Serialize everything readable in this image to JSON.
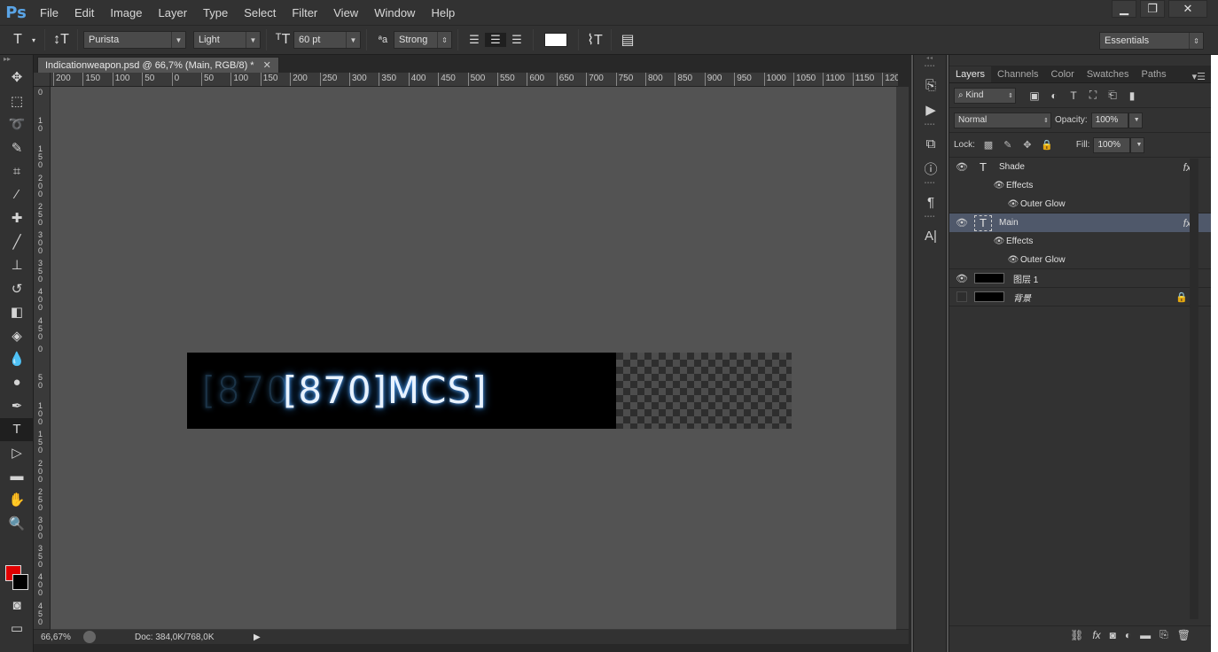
{
  "app": {
    "logo": "Ps"
  },
  "menu": [
    "File",
    "Edit",
    "Image",
    "Layer",
    "Type",
    "Select",
    "Filter",
    "View",
    "Window",
    "Help"
  ],
  "window_controls": {
    "minimize": "▁",
    "restore": "❐",
    "close": "✕"
  },
  "options": {
    "font_family": "Purista",
    "font_style": "Light",
    "font_size": "60 pt",
    "aa_label": "ªa",
    "antialias": "Strong",
    "text_color": "#ffffff",
    "workspace": "Essentials"
  },
  "document": {
    "tab_title": "Indicationweapon.psd @ 66,7% (Main, RGB/8) *",
    "ruler_h": [
      "200",
      "150",
      "100",
      "50",
      "0",
      "50",
      "100",
      "150",
      "200",
      "250",
      "300",
      "350",
      "400",
      "450",
      "500",
      "550",
      "600",
      "650",
      "700",
      "750",
      "800",
      "850",
      "900",
      "950",
      "1000",
      "1050",
      "1100",
      "1150",
      "120"
    ],
    "ruler_v": [
      "0",
      "1\n0",
      "1\n5\n0",
      "2\n0\n0",
      "2\n5\n0",
      "3\n0\n0",
      "3\n5\n0",
      "4\n0\n0",
      "4\n5\n0",
      "0",
      "5\n0",
      "1\n0\n0",
      "1\n5\n0",
      "2\n0\n0",
      "2\n5\n0",
      "3\n0\n0",
      "3\n5\n0",
      "4\n0\n0",
      "4\n5\n0"
    ],
    "shade_text": "[870",
    "main_text": "[870]MCS]",
    "checker_color": "#4d4d4d"
  },
  "status": {
    "zoom": "66,67%",
    "doc": "Doc: 384,0K/768,0K"
  },
  "layers_panel": {
    "tabs": [
      "Layers",
      "Channels",
      "Color",
      "Swatches",
      "Paths"
    ],
    "filter_kind": "Kind",
    "blend_mode": "Normal",
    "opacity_label": "Opacity:",
    "opacity": "100%",
    "lock_label": "Lock:",
    "fill_label": "Fill:",
    "fill": "100%",
    "layers": [
      {
        "name": "Shade",
        "effects": "Effects",
        "effect": "Outer Glow"
      },
      {
        "name": "Main",
        "effects": "Effects",
        "effect": "Outer Glow"
      },
      {
        "name": "图层 1"
      },
      {
        "name": "背景"
      }
    ]
  }
}
